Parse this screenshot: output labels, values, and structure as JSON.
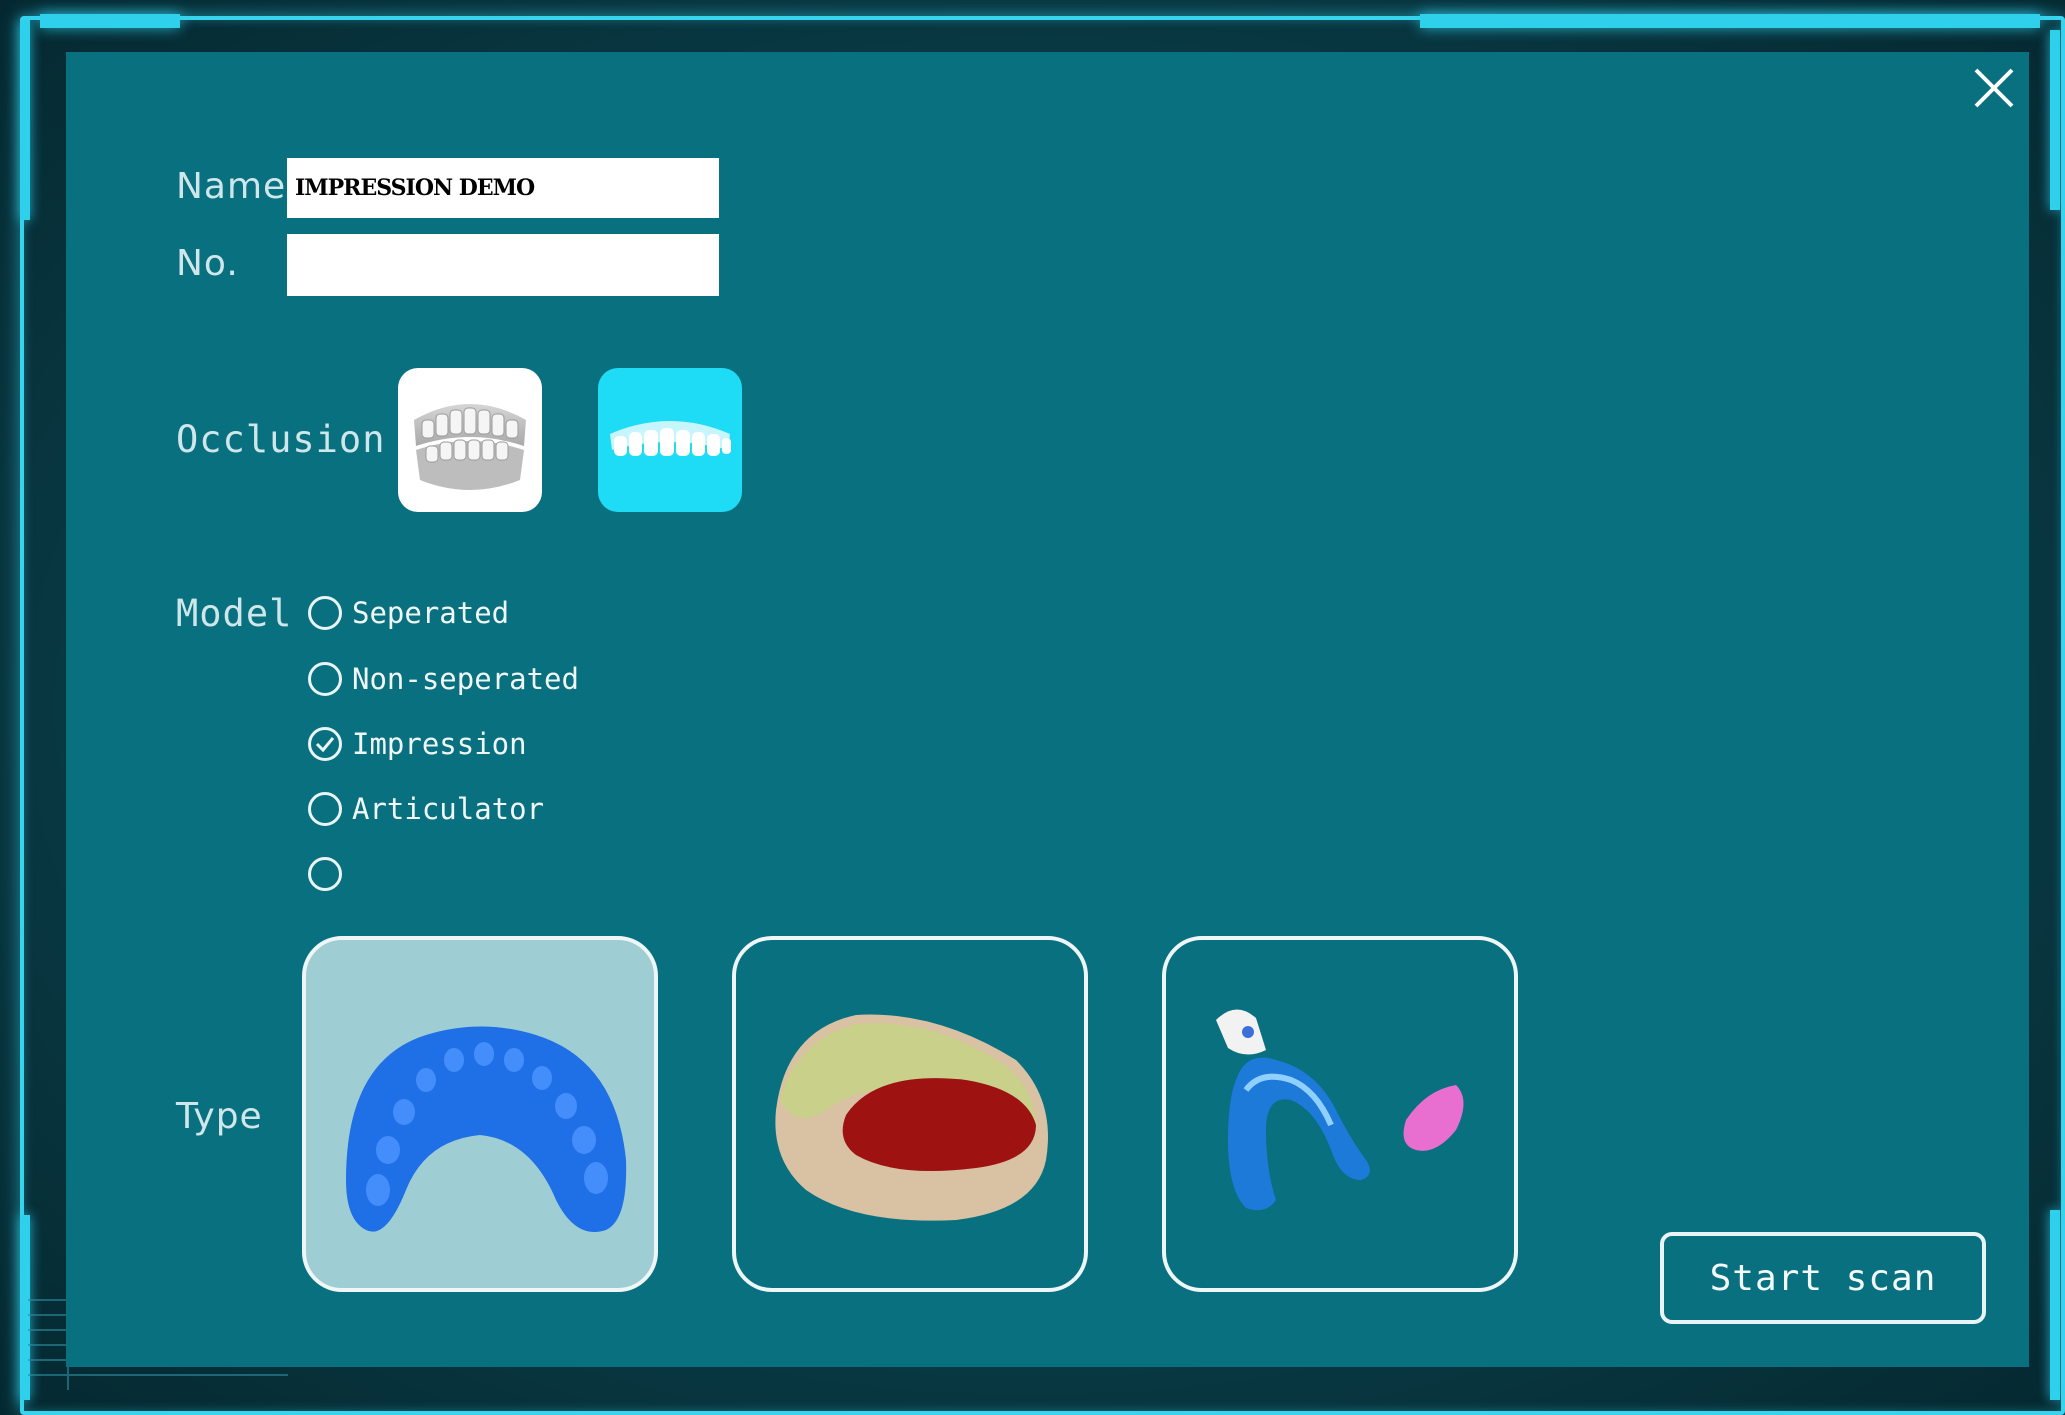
{
  "form": {
    "name_label": "Name",
    "name_value": "IMPRESSION DEMO",
    "no_label": "No.",
    "no_value": "",
    "occlusion_label": "Occlusion",
    "model_label": "Model",
    "type_label": "Type"
  },
  "occlusion_options": [
    {
      "icon": "full-dentition-icon",
      "selected": false
    },
    {
      "icon": "upper-arch-icon",
      "selected": true
    }
  ],
  "model_options": [
    {
      "label": "Seperated",
      "checked": false
    },
    {
      "label": "Non-seperated",
      "checked": false
    },
    {
      "label": "Impression",
      "checked": true
    },
    {
      "label": "Articulator",
      "checked": false
    },
    {
      "label": "",
      "checked": false
    }
  ],
  "type_options": [
    {
      "icon": "blue-impression-tray-icon",
      "selected": true
    },
    {
      "icon": "stone-model-with-bite-icon",
      "selected": false
    },
    {
      "icon": "impression-tray-with-handle-icon",
      "selected": false
    }
  ],
  "actions": {
    "start_scan_label": "Start scan"
  },
  "colors": {
    "panel": "#08707f",
    "frame_glow": "#38d4ee",
    "selected_occlusion": "#1fdcf6",
    "selected_type": "#9fcdd4"
  }
}
